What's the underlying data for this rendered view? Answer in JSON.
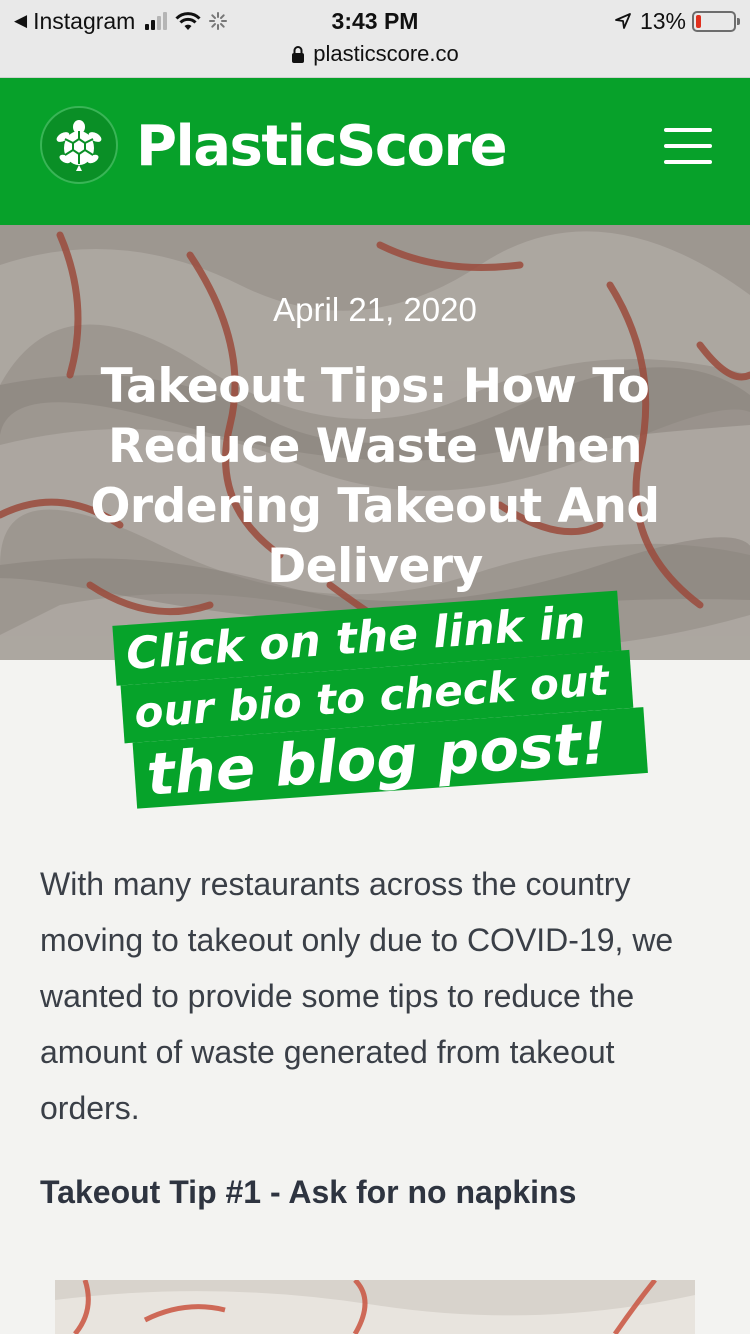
{
  "status_bar": {
    "back_app": "Instagram",
    "time": "3:43 PM",
    "battery_percent": "13%",
    "battery_level": 0.13,
    "icons": [
      "back-arrow-icon",
      "cellular-signal-icon",
      "wifi-icon",
      "loading-spinner-icon",
      "location-arrow-icon",
      "battery-icon"
    ]
  },
  "url_bar": {
    "url": "plasticscore.co",
    "icon": "lock-icon"
  },
  "header": {
    "brand": "PlasticScore",
    "logo_icon": "turtle-icon",
    "menu_icon": "hamburger-menu-icon",
    "background_color": "#07a12a"
  },
  "hero": {
    "date": "April 21, 2020",
    "title": "Takeout Tips: How To Reduce Waste When Ordering Takeout And Delivery"
  },
  "sticker": {
    "line1": "Click on the link in",
    "line2": "our bio to check out",
    "line3": "the blog post!",
    "color": "#06a32a"
  },
  "article": {
    "intro": "With many restaurants across the country moving to takeout only due to COVID-19, we wanted to provide some tips to reduce the amount of waste generated from takeout orders.",
    "subheading": "Takeout Tip #1 - Ask for no napkins"
  }
}
